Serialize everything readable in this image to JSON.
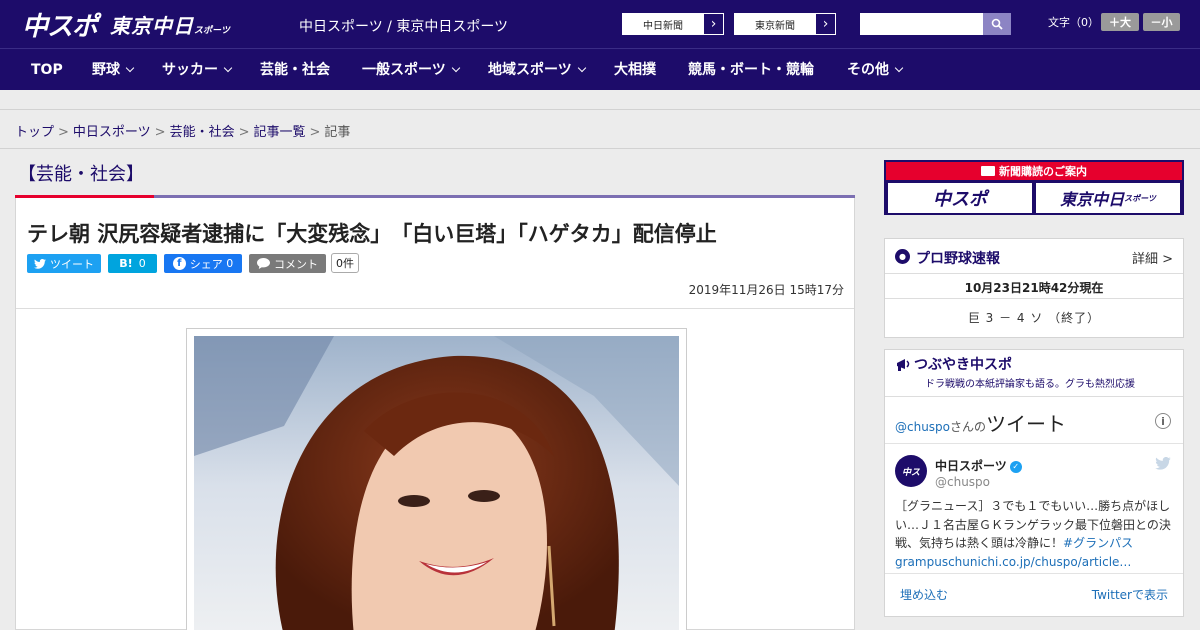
{
  "header": {
    "logo": "中スポ",
    "logo2": "東京中日",
    "logo2_small": "スポーツ",
    "site_title": "中日スポーツ / 東京中日スポーツ",
    "link1": "中日新聞",
    "link2": "東京新聞",
    "fontsize_label": "文字（0）",
    "font_plus": "＋大",
    "font_minus": "－小"
  },
  "nav": {
    "items": [
      "TOP",
      "野球",
      "サッカー",
      "芸能・社会",
      "一般スポーツ",
      "地域スポーツ",
      "大相撲",
      "競馬・ボート・競輪",
      "その他"
    ]
  },
  "breadcrumb": {
    "items": [
      "トップ",
      "中日スポーツ",
      "芸能・社会",
      "記事一覧"
    ],
    "current": "記事",
    "sep": ">"
  },
  "article": {
    "category": "【芸能・社会】",
    "headline": "テレ朝 沢尻容疑者逮捕に「大変残念」　「白い巨塔」「ハゲタカ」配信停止",
    "share_tweet": "ツイート",
    "share_hatena": "B!",
    "share_hatena_count": "0",
    "share_fb": "シェア",
    "share_fb_count": "0",
    "share_comment": "コメント",
    "comment_count": "0件",
    "date": "2019年11月26日 15時17分"
  },
  "sidebar": {
    "ad_header": "新聞購読のご案内",
    "ad_left": "中スポ",
    "ad_right": "東京中日",
    "ad_right_small": "スポーツ",
    "baseball": {
      "title": "プロ野球速報",
      "detail": "詳細 >",
      "time": "10月23日21時42分現在",
      "score": "巨 3 － 4 ソ （終了）"
    },
    "tweets": {
      "title": "つぶやき中スポ",
      "subtitle": "ドラ戦戦の本紙評論家も語る。グラも熱烈応援",
      "user_prefix": "@chuspo",
      "user_suffix": "さんの",
      "label": "ツイート",
      "name": "中日スポーツ",
      "handle": "@chuspo",
      "text": "［グラニュース］３でも１でもいい…勝ち点がほしい…Ｊ１名古屋ＧＫランゲラック最下位磐田との決戦、気持ちは熱く頭は冷静に！",
      "hashtag": "#グランパス",
      "url": "grampuschunichi.co.jp/chuspo/article…",
      "embed": "埋め込む",
      "view": "Twitterで表示"
    }
  },
  "colors": {
    "brand_navy": "#1d0c6a",
    "accent_red": "#e6002d",
    "twitter_blue": "#1da1f2",
    "facebook_blue": "#1877f2",
    "hatena_blue": "#00a4de"
  }
}
